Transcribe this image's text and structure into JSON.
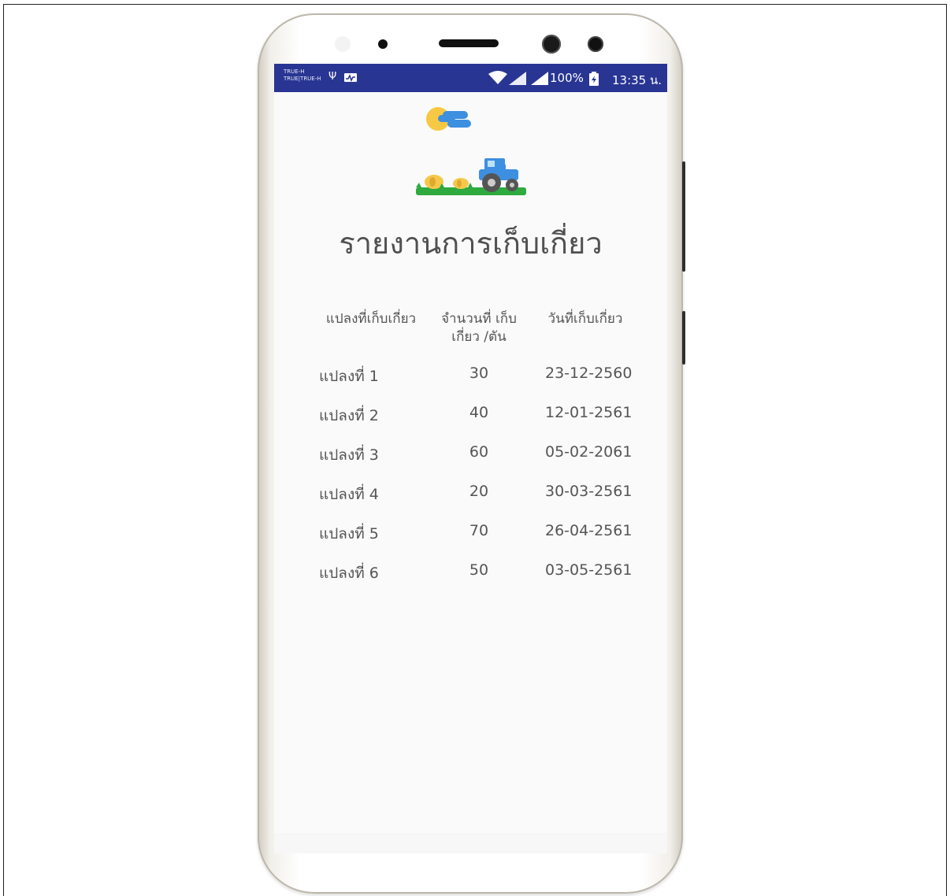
{
  "status_bar": {
    "carrier_line1": "TRUE-H",
    "carrier_line2": "TRUE|TRUE-H",
    "battery": "100%",
    "time": "13:35 น."
  },
  "colors": {
    "status_bar": "#283593",
    "screen_bg": "#fafafa",
    "text": "#555555",
    "tractor": "#3d8fe0",
    "grass": "#2eaa3f",
    "hay": "#f5c84a"
  },
  "icons": [
    "sun-cloud-icon",
    "tractor-icon",
    "wifi-icon",
    "signal-icon",
    "battery-icon",
    "usb-icon"
  ],
  "report": {
    "title": "รายงานการเก็บเกี่ยว",
    "headers": {
      "plot": "แปลงที่เก็บเกี่ยว",
      "amount_line1": "จำนวนที่ เก็บ",
      "amount_line2": "เกี่ยว /ตัน",
      "date": "วันที่เก็บเกี่ยว"
    },
    "rows": [
      {
        "plot": "แปลงที่ 1",
        "amount": "30",
        "date": "23-12-2560"
      },
      {
        "plot": "แปลงที่ 2",
        "amount": "40",
        "date": "12-01-2561"
      },
      {
        "plot": "แปลงที่ 3",
        "amount": "60",
        "date": "05-02-2061"
      },
      {
        "plot": "แปลงที่ 4",
        "amount": "20",
        "date": "30-03-2561"
      },
      {
        "plot": "แปลงที่ 5",
        "amount": "70",
        "date": "26-04-2561"
      },
      {
        "plot": "แปลงที่ 6",
        "amount": "50",
        "date": "03-05-2561"
      }
    ]
  }
}
